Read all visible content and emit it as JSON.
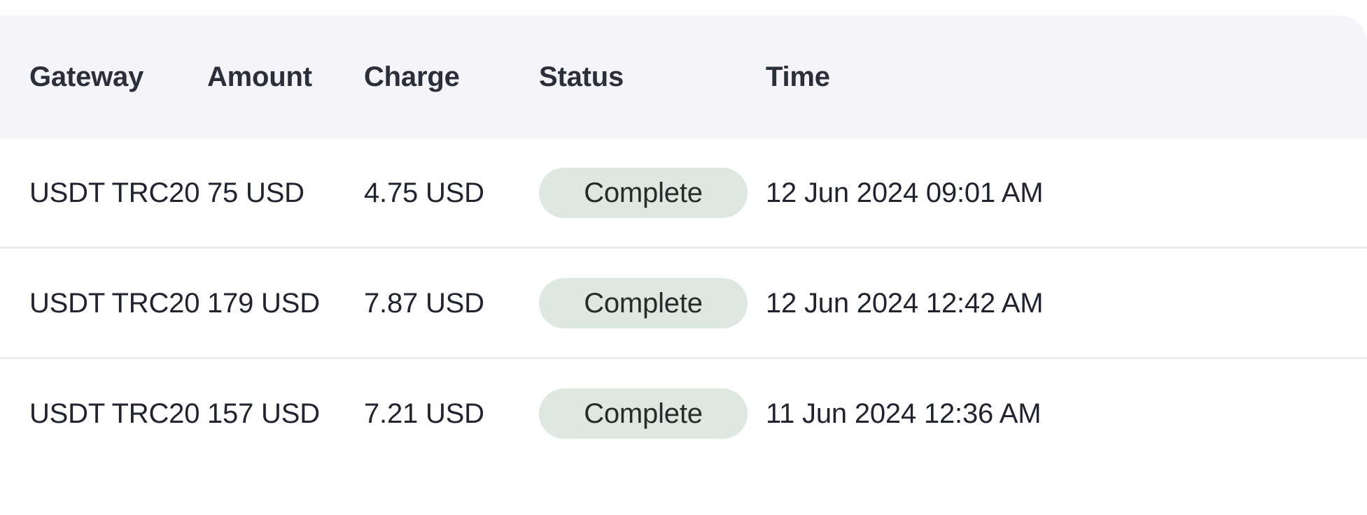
{
  "table": {
    "columns": [
      {
        "key": "gateway",
        "label": "Gateway"
      },
      {
        "key": "amount",
        "label": "Amount"
      },
      {
        "key": "charge",
        "label": "Charge"
      },
      {
        "key": "status",
        "label": "Status"
      },
      {
        "key": "time",
        "label": "Time"
      }
    ],
    "rows": [
      {
        "gateway": "USDT TRC20",
        "amount": "75 USD",
        "charge": "4.75 USD",
        "status": "Complete",
        "time": "12 Jun 2024 09:01 AM"
      },
      {
        "gateway": "USDT TRC20",
        "amount": "179 USD",
        "charge": "7.87 USD",
        "status": "Complete",
        "time": "12 Jun 2024 12:42 AM"
      },
      {
        "gateway": "USDT TRC20",
        "amount": "157 USD",
        "charge": "7.21 USD",
        "status": "Complete",
        "time": "11 Jun 2024 12:36 AM"
      }
    ]
  },
  "colors": {
    "header_background": "#f4f4f9",
    "header_text": "#2b2f3a",
    "row_text": "#1f2430",
    "row_divider": "#ececf0",
    "status_complete_background": "#dce8e0",
    "status_complete_text": "#252c2a",
    "time_text": "#94a0ad",
    "panel_background": "#ffffff"
  }
}
